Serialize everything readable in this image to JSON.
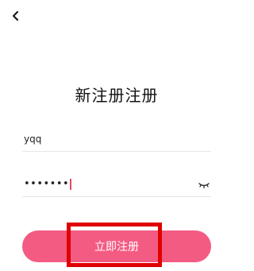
{
  "header": {
    "back_icon": "chevron-left-icon"
  },
  "title": "新注册注册",
  "form": {
    "username_value": "yqq",
    "password_value": "•••••••",
    "password_toggle_icon": "eye-closed-icon"
  },
  "actions": {
    "register_label": "立即注册"
  },
  "colors": {
    "accent": "#f45b83",
    "caret": "#e84a5f",
    "highlight": "#e00000"
  }
}
